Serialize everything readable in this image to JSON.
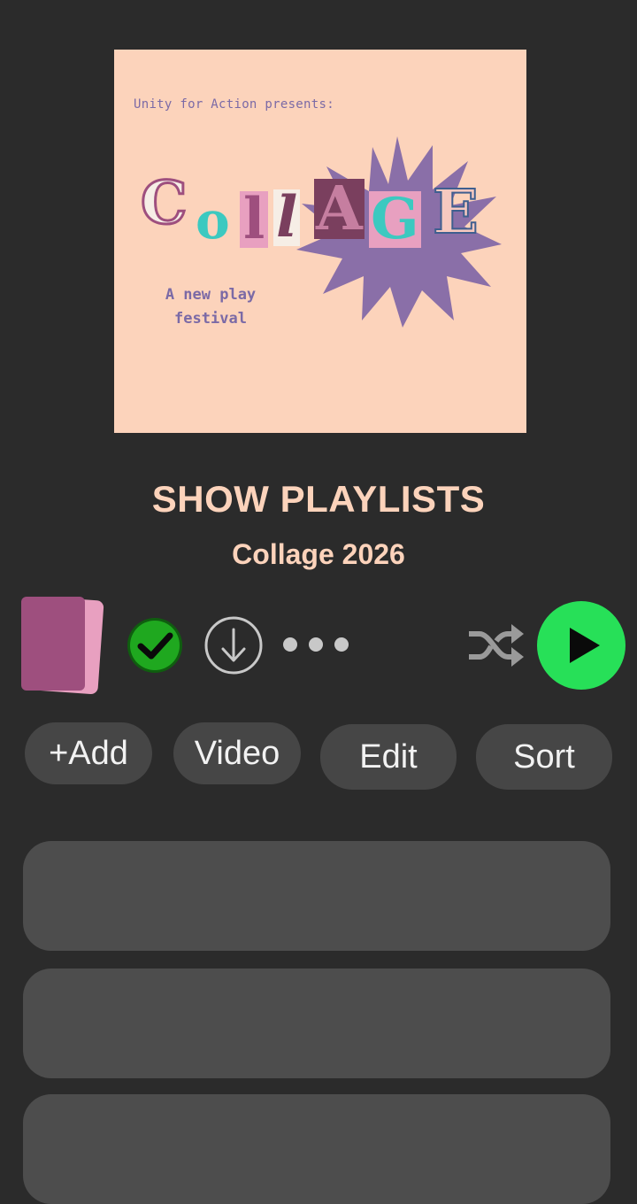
{
  "cover": {
    "presents_text": "Unity for Action presents:",
    "logo_word": "Collage",
    "tagline_line1": "A new play",
    "tagline_line2": "festival",
    "bg_color": "#fcd3bb"
  },
  "header": {
    "title": "SHOW PLAYLISTS",
    "subtitle": "Collage 2026"
  },
  "controls": {
    "saved_icon": "check-circle-icon",
    "download_icon": "download-icon",
    "more_icon": "more-dots-icon",
    "shuffle_icon": "shuffle-icon",
    "play_icon": "play-icon",
    "play_color": "#27e058",
    "check_color": "#1fa81f"
  },
  "actions": {
    "add_label": "+Add",
    "video_label": "Video",
    "edit_label": "Edit",
    "sort_label": "Sort"
  },
  "list": {
    "rows": [
      "",
      "",
      ""
    ]
  }
}
